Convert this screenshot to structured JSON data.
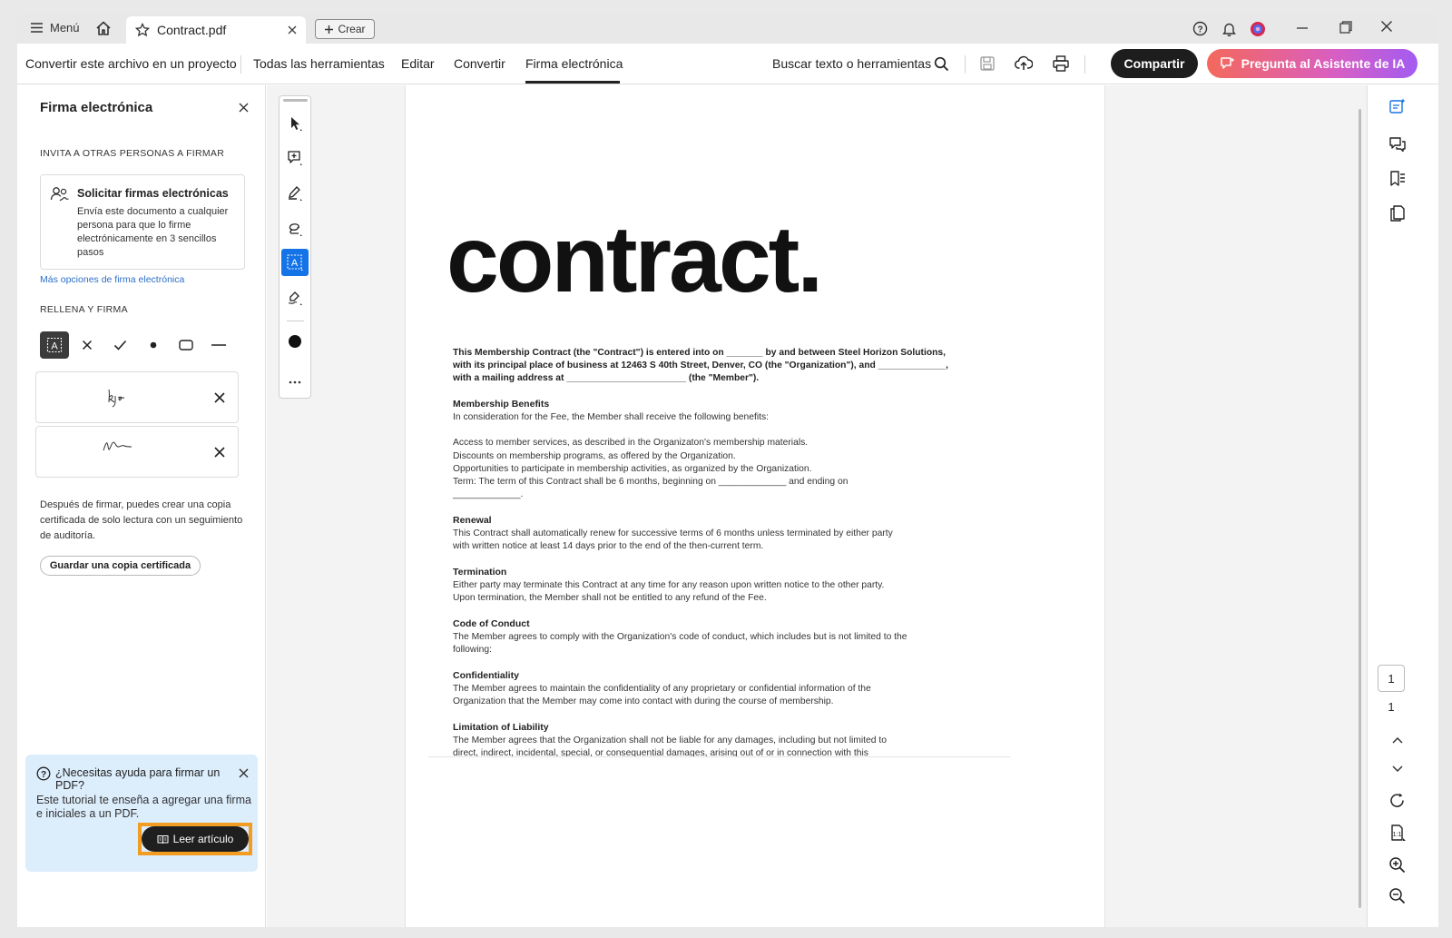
{
  "titlebar": {
    "menu_label": "Menú",
    "tab_title": "Contract.pdf",
    "create_label": "Crear"
  },
  "toolbar": {
    "convert_project": "Convertir este archivo en un proyecto",
    "nav": [
      "Todas las herramientas",
      "Editar",
      "Convertir",
      "Firma electrónica"
    ],
    "search_label": "Buscar texto o herramientas",
    "share_label": "Compartir",
    "ai_label": "Pregunta al Asistente de IA"
  },
  "left_panel": {
    "title": "Firma electrónica",
    "invite_heading": "INVITA A OTRAS PERSONAS A FIRMAR",
    "request_title": "Solicitar firmas electrónicas",
    "request_desc": "Envía este documento a cualquier persona para que lo firme electrónicamente en 3 sencillos pasos",
    "more_options": "Más opciones de firma electrónica",
    "fill_heading": "RELLENA Y FIRMA",
    "fill_tools": [
      "text-field-icon",
      "x-mark-icon",
      "check-mark-icon",
      "dot-icon",
      "rectangle-icon",
      "line-icon"
    ],
    "after_sign": "Después de firmar, puedes crear una copia certificada de solo lectura con un seguimiento de auditoría.",
    "cert_button": "Guardar una copia certificada",
    "help": {
      "title": "¿Necesitas ayuda para firmar un PDF?",
      "body": "Este tutorial te enseña a agregar una firma e iniciales a un PDF.",
      "button": "Leer artículo"
    }
  },
  "document": {
    "big_title": "contract.",
    "intro": "This Membership Contract (the \"Contract\") is entered into on _______ by and between Steel Horizon Solutions, with its principal place of business at 12463 S 40th Street, Denver, CO (the \"Organization\"), and _____________, with a mailing address at _______________________ (the \"Member\").",
    "sections": [
      {
        "heading": "Membership Benefits",
        "body": "In consideration for the Fee, the Member shall receive the following benefits:\n\nAccess to member services, as described in the Organizaton's membership materials.\nDiscounts on membership programs, as offered by the Organization.\nOpportunities to participate in membership activities, as organized by the Organization.\nTerm: The term of this Contract shall be 6 months, beginning on _____________ and ending on\n_____________."
      },
      {
        "heading": "Renewal",
        "body": "This Contract shall automatically renew for successive terms of 6 months unless terminated by either party\nwith written notice at least 14 days prior to the end of the then-current term."
      },
      {
        "heading": "Termination",
        "body": "Either party may terminate this Contract at any time for any reason upon written notice to the other party.\nUpon termination, the Member shall not be entitled to any refund of the Fee."
      },
      {
        "heading": "Code of Conduct",
        "body": "The Member agrees to comply with the Organization's code of conduct, which includes but is not limited to the\nfollowing:"
      },
      {
        "heading": "Confidentiality",
        "body": "The Member agrees to maintain the confidentiality of any proprietary or confidential information of the\nOrganization that the Member may come into contact with during the course of membership."
      },
      {
        "heading": "Limitation of Liability",
        "body": "The Member agrees that the Organization shall not be liable for any damages, including but not limited to\ndirect, indirect, incidental, special, or consequential damages, arising out of or in connection with this"
      }
    ]
  },
  "right_rail": {
    "current_page": "1",
    "total_pages": "1"
  },
  "colors": {
    "accent_blue": "#1473e6",
    "share_bg": "#1d1d1d",
    "ai_gradient_start": "#f4695b",
    "ai_gradient_end": "#a35cf2",
    "highlight_orange": "#f29c22",
    "help_bg": "#dcedfc"
  }
}
